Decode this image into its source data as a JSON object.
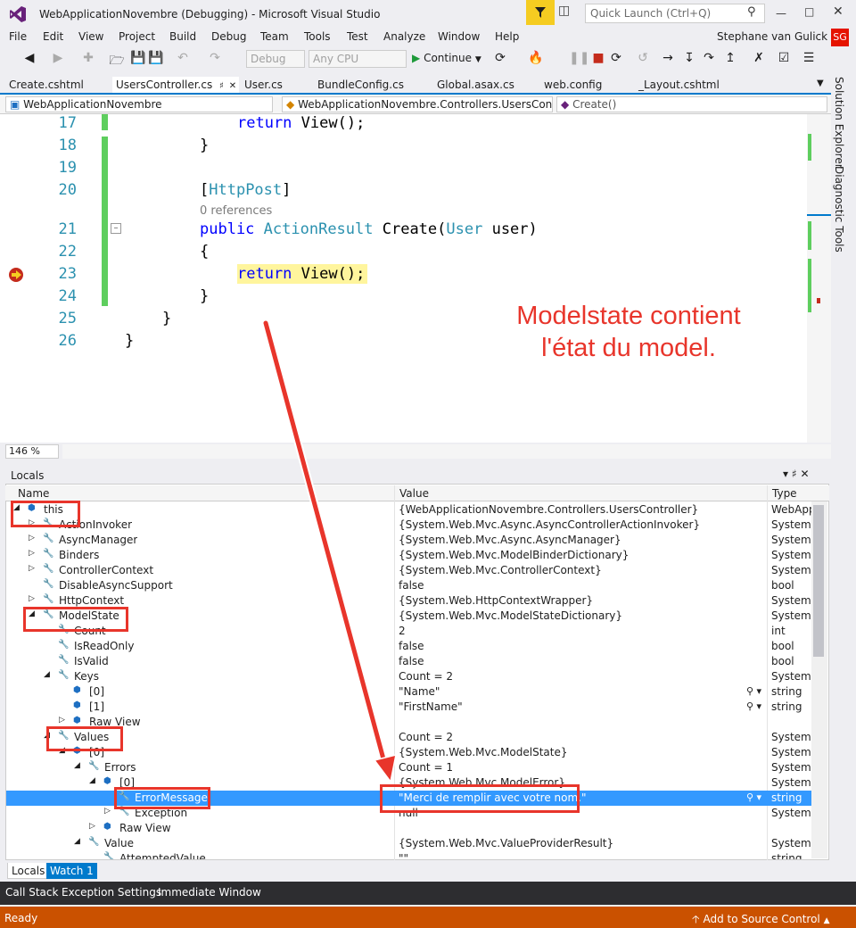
{
  "window": {
    "title": "WebApplicationNovembre (Debugging) - Microsoft Visual Studio",
    "quick_launch_placeholder": "Quick Launch (Ctrl+Q)",
    "user": "Stephane van Gulick",
    "user_initials": "SG"
  },
  "menu": [
    "File",
    "Edit",
    "View",
    "Project",
    "Build",
    "Debug",
    "Team",
    "Tools",
    "Test",
    "Analyze",
    "Window",
    "Help"
  ],
  "toolbar": {
    "config": "Debug",
    "platform": "Any CPU",
    "continue_label": "Continue"
  },
  "tabs": [
    "Create.cshtml",
    "UsersController.cs",
    "User.cs",
    "BundleConfig.cs",
    "Global.asax.cs",
    "web.config",
    "_Layout.cshtml"
  ],
  "active_tab": "UsersController.cs",
  "navbar": {
    "project": "WebApplicationNovembre",
    "class": "WebApplicationNovembre.Controllers.UsersContro",
    "member": "Create()"
  },
  "editor": {
    "lines": [
      {
        "num": "17",
        "code": "return View();"
      },
      {
        "num": "18",
        "code": "}"
      },
      {
        "num": "19",
        "code": ""
      },
      {
        "num": "20",
        "code": "[HttpPost]"
      },
      {
        "num": "21",
        "code": "public ActionResult Create(User user)"
      },
      {
        "num": "22",
        "code": "{"
      },
      {
        "num": "23",
        "code": "return View();"
      },
      {
        "num": "24",
        "code": "}"
      },
      {
        "num": "25",
        "code": "}"
      },
      {
        "num": "26",
        "code": "}"
      }
    ],
    "codelens": "0 references",
    "zoom": "146 %"
  },
  "annotation": "Modelstate contient l'état du model.",
  "side_tabs": [
    "Solution Explorer",
    "Diagnostic Tools"
  ],
  "locals": {
    "title": "Locals",
    "columns": [
      "Name",
      "Value",
      "Type"
    ],
    "rows": [
      {
        "name": "this",
        "value": "{WebApplicationNovembre.Controllers.UsersController}",
        "type": "WebApp"
      },
      {
        "name": "ActionInvoker",
        "value": "{System.Web.Mvc.Async.AsyncControllerActionInvoker}",
        "type": "System.W"
      },
      {
        "name": "AsyncManager",
        "value": "{System.Web.Mvc.Async.AsyncManager}",
        "type": "System.W"
      },
      {
        "name": "Binders",
        "value": "{System.Web.Mvc.ModelBinderDictionary}",
        "type": "System.W"
      },
      {
        "name": "ControllerContext",
        "value": "{System.Web.Mvc.ControllerContext}",
        "type": "System.W"
      },
      {
        "name": "DisableAsyncSupport",
        "value": "false",
        "type": "bool"
      },
      {
        "name": "HttpContext",
        "value": "{System.Web.HttpContextWrapper}",
        "type": "System.W"
      },
      {
        "name": "ModelState",
        "value": "{System.Web.Mvc.ModelStateDictionary}",
        "type": "System.W"
      },
      {
        "name": "Count",
        "value": "2",
        "type": "int"
      },
      {
        "name": "IsReadOnly",
        "value": "false",
        "type": "bool"
      },
      {
        "name": "IsValid",
        "value": "false",
        "type": "bool"
      },
      {
        "name": "Keys",
        "value": "Count = 2",
        "type": "System.C"
      },
      {
        "name": "[0]",
        "value": "\"Name\"",
        "type": "string"
      },
      {
        "name": "[1]",
        "value": "\"FirstName\"",
        "type": "string"
      },
      {
        "name": "Raw View",
        "value": "",
        "type": ""
      },
      {
        "name": "Values",
        "value": "Count = 2",
        "type": "System.C"
      },
      {
        "name": "[0]",
        "value": "{System.Web.Mvc.ModelState}",
        "type": "System.W"
      },
      {
        "name": "Errors",
        "value": "Count = 1",
        "type": "System.W"
      },
      {
        "name": "[0]",
        "value": "{System.Web.Mvc.ModelError}",
        "type": "System.W"
      },
      {
        "name": "ErrorMessage",
        "value": "\"Merci de remplir avec votre nom.\"",
        "type": "string"
      },
      {
        "name": "Exception",
        "value": "null",
        "type": "System.E"
      },
      {
        "name": "Raw View",
        "value": "",
        "type": ""
      },
      {
        "name": "Value",
        "value": "{System.Web.Mvc.ValueProviderResult}",
        "type": "System.W"
      },
      {
        "name": "AttemptedValue",
        "value": "\"\"",
        "type": "string"
      }
    ]
  },
  "bottom_tabs": [
    "Locals",
    "Watch 1"
  ],
  "tool_tabs": [
    "Call Stack",
    "Exception Settings",
    "Immediate Window"
  ],
  "status": {
    "text": "Ready",
    "source_control": "Add to Source Control"
  },
  "colors": {
    "accent": "#007acc",
    "status_bar": "#ca5100",
    "annotation": "#e8352b",
    "selection": "#3399ff"
  }
}
